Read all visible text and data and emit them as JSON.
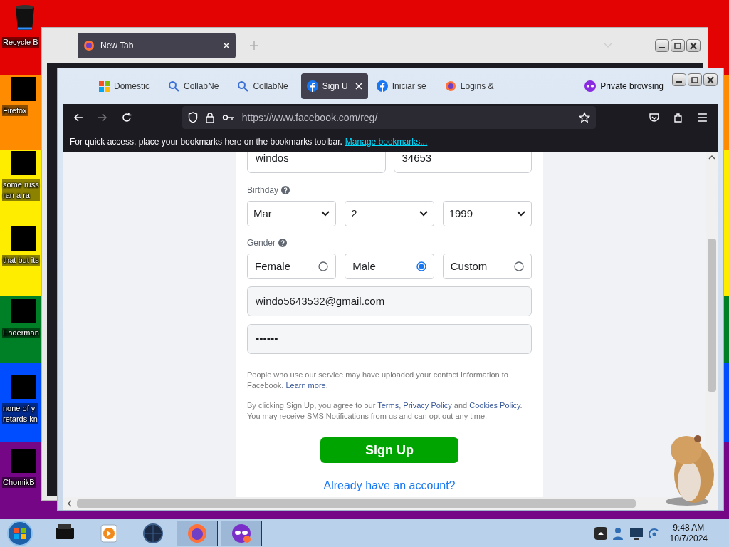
{
  "desktop": {
    "icons": [
      {
        "kind": "bin",
        "lines": [
          "Recycle B"
        ]
      },
      {
        "kind": "blocked",
        "lines": [
          "Firefox"
        ]
      },
      {
        "kind": "blocked",
        "lines": [
          "some russ",
          "ran a ra"
        ]
      },
      {
        "kind": "blocked",
        "lines": [
          "that but its"
        ]
      },
      {
        "kind": "blocked",
        "lines": [
          "Enderman"
        ]
      },
      {
        "kind": "blocked",
        "lines": [
          "none of y",
          "retards kn"
        ]
      },
      {
        "kind": "blocked",
        "lines": [
          "ChomikB"
        ]
      }
    ]
  },
  "back_window": {
    "tabs": [
      {
        "title": "New Tab",
        "selected": true
      }
    ]
  },
  "browser": {
    "tabs": [
      {
        "kind": "windows",
        "title": "Domestic",
        "selected": false
      },
      {
        "kind": "search",
        "title": "CollabNe",
        "selected": false
      },
      {
        "kind": "search",
        "title": "CollabNe",
        "selected": false
      },
      {
        "kind": "facebook",
        "title": "Sign U",
        "selected": true
      },
      {
        "kind": "facebook",
        "title": "Iniciar se",
        "selected": false
      },
      {
        "kind": "firefox",
        "title": "Logins &",
        "selected": false
      }
    ],
    "private_label": "Private browsing",
    "url": "https://www.facebook.com/reg/",
    "bookmarks_message": "For quick access, place your bookmarks here on the bookmarks toolbar.",
    "bookmarks_link": "Manage bookmarks..."
  },
  "form": {
    "first_name": "windos",
    "last_name": "34653",
    "birthday_label": "Birthday",
    "birthday": [
      "Mar",
      "2",
      "1999"
    ],
    "gender_label": "Gender",
    "genders": [
      {
        "label": "Female",
        "selected": false
      },
      {
        "label": "Male",
        "selected": true
      },
      {
        "label": "Custom",
        "selected": false
      }
    ],
    "email": "windo5643532@gmail.com",
    "password": "••••••",
    "contact_notice": [
      {
        "text": "People who use our service may have uploaded your contact information to Facebook. ",
        "link": false
      },
      {
        "text": "Learn more",
        "link": true
      },
      {
        "text": ".",
        "link": false
      }
    ],
    "terms_notice": [
      {
        "text": "By clicking Sign Up, you agree to our ",
        "link": false
      },
      {
        "text": "Terms",
        "link": true
      },
      {
        "text": ", ",
        "link": false
      },
      {
        "text": "Privacy Policy",
        "link": true
      },
      {
        "text": " and ",
        "link": false
      },
      {
        "text": "Cookies Policy",
        "link": true
      },
      {
        "text": ". You may receive SMS Notifications from us and can opt out any time.",
        "link": false
      }
    ],
    "submit": "Sign Up",
    "login_link": "Already have an account?"
  },
  "taskbar": {
    "apps": [
      {
        "kind": "printer",
        "selected": false
      },
      {
        "kind": "media",
        "selected": false
      },
      {
        "kind": "globe",
        "selected": false
      },
      {
        "kind": "firefox",
        "selected": true
      },
      {
        "kind": "private",
        "selected": true
      }
    ],
    "time": "9:48 AM",
    "date": "10/7/2024"
  }
}
